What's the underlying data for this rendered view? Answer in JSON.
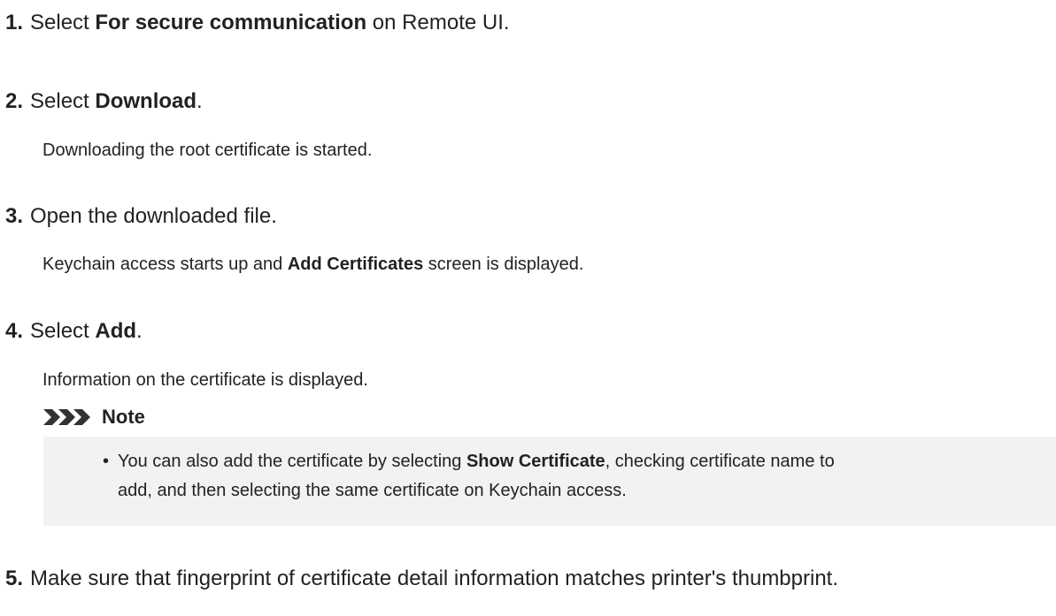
{
  "steps": [
    {
      "number": "1.",
      "pre": "Select ",
      "bold": "For secure communication",
      "post": " on Remote UI."
    },
    {
      "number": "2.",
      "pre": "Select ",
      "bold": "Download",
      "post": ".",
      "description": "Downloading the root certificate is started."
    },
    {
      "number": "3.",
      "text": "Open the downloaded file.",
      "description_pre": "Keychain access starts up and ",
      "description_bold": "Add Certificates",
      "description_post": " screen is displayed."
    },
    {
      "number": "4.",
      "pre": "Select ",
      "bold": "Add",
      "post": ".",
      "description": "Information on the certificate is displayed."
    },
    {
      "number": "5.",
      "text": "Make sure that fingerprint of certificate detail information matches printer's thumbprint."
    }
  ],
  "note": {
    "title": "Note",
    "icon": "triple-chevron-icon",
    "item_pre": "You can also add the certificate by selecting ",
    "item_bold": "Show Certificate",
    "item_post_line1": ", checking certificate name to",
    "item_line2": "add, and then selecting the same certificate on Keychain access."
  },
  "colors": {
    "text": "#222222",
    "note_background": "#f2f2f2",
    "note_icon": "#333333"
  }
}
